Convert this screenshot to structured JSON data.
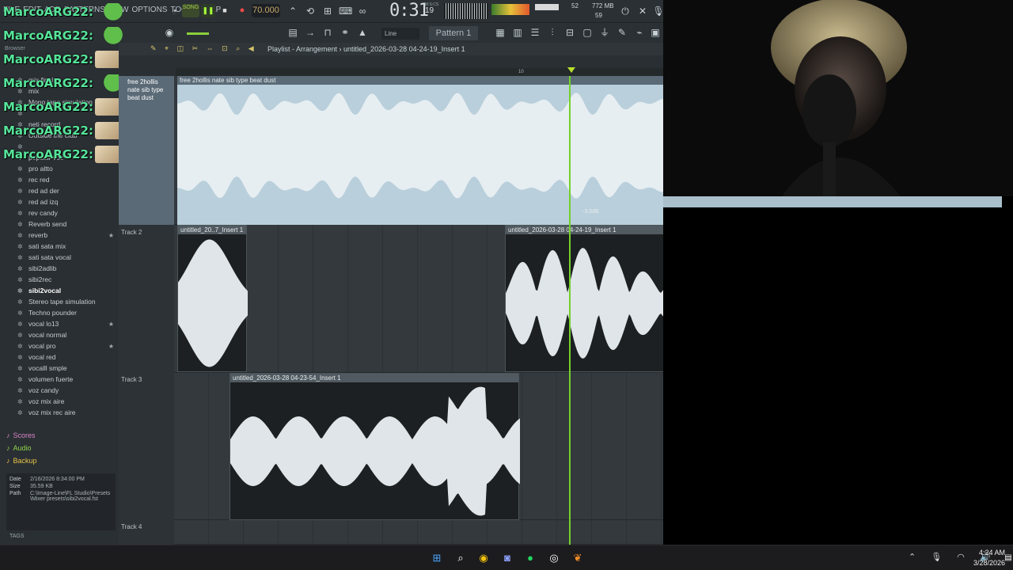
{
  "menus": [
    "FILE",
    "EDIT",
    "ADD",
    "PATTERNS",
    "VIEW",
    "OPTIONS",
    "TOOLS",
    "HELP"
  ],
  "transport": {
    "song_label": "SONG",
    "tempo": "70.000",
    "time": "0:31",
    "time_small": "19",
    "time_unit": "M:S:CS"
  },
  "monitor": {
    "cpu": "52",
    "memory": "772 MB",
    "polyphony": "59"
  },
  "toolbar2": {
    "snap": "Line",
    "pattern": "Pattern 1"
  },
  "chat": {
    "username": "MarcoARG22:",
    "messages": [
      {
        "emote": "frog-emote"
      },
      {
        "emote": "frog-emote"
      },
      {
        "emote": "dog-emote"
      },
      {
        "emote": "frog-emote"
      },
      {
        "emote": "dog-emote"
      },
      {
        "emote": "dog-emote"
      },
      {
        "emote": "dog-emote"
      }
    ]
  },
  "browser": {
    "header": "Browser",
    "items": [
      {
        "label": "mix final",
        "star": false,
        "selected": false
      },
      {
        "label": "mix",
        "star": false,
        "selected": false
      },
      {
        "label": "Mono tape simulation",
        "star": false,
        "selected": false
      },
      {
        "label": "",
        "star": false,
        "selected": false
      },
      {
        "label": "neti record",
        "star": false,
        "selected": false
      },
      {
        "label": "Outside the club",
        "star": false,
        "selected": false
      },
      {
        "label": "",
        "star": false,
        "selected": false
      },
      {
        "label": "popular voc",
        "star": false,
        "selected": false
      },
      {
        "label": "pro altto",
        "star": false,
        "selected": false
      },
      {
        "label": "rec red",
        "star": false,
        "selected": false
      },
      {
        "label": "red ad der",
        "star": false,
        "selected": false
      },
      {
        "label": "red ad izq",
        "star": false,
        "selected": false
      },
      {
        "label": "rev candy",
        "star": false,
        "selected": false
      },
      {
        "label": "Reverb send",
        "star": false,
        "selected": false
      },
      {
        "label": "reverb",
        "star": true,
        "selected": false
      },
      {
        "label": "sati sata mix",
        "star": false,
        "selected": false
      },
      {
        "label": "sati sata vocal",
        "star": false,
        "selected": false
      },
      {
        "label": "sibi2adlib",
        "star": false,
        "selected": false
      },
      {
        "label": "sibi2rec",
        "star": false,
        "selected": false
      },
      {
        "label": "sibi2vocal",
        "star": false,
        "selected": true
      },
      {
        "label": "Stereo tape simulation",
        "star": false,
        "selected": false
      },
      {
        "label": "Techno pounder",
        "star": false,
        "selected": false
      },
      {
        "label": "vocal lo13",
        "star": true,
        "selected": false
      },
      {
        "label": "vocal normal",
        "star": false,
        "selected": false
      },
      {
        "label": "vocal pro",
        "star": true,
        "selected": false
      },
      {
        "label": "vocal red",
        "star": false,
        "selected": false
      },
      {
        "label": "vocalll smple",
        "star": false,
        "selected": false
      },
      {
        "label": "volumen fuerte",
        "star": false,
        "selected": false
      },
      {
        "label": "voz candy",
        "star": false,
        "selected": false
      },
      {
        "label": "voz mix aire",
        "star": false,
        "selected": false
      },
      {
        "label": "voz mix rec aire",
        "star": false,
        "selected": false
      }
    ],
    "categories": [
      {
        "label": "Scores",
        "color": "#d784c8"
      },
      {
        "label": "Audio",
        "color": "#8fd44a"
      },
      {
        "label": "Backup",
        "color": "#e8c348"
      }
    ],
    "fileinfo": {
      "date_k": "Date",
      "date_v": "2/16/2026 8:34:00 PM",
      "size_k": "Size",
      "size_v": "35.59 KB",
      "path_k": "Path",
      "path_v": "C:\\Image-Line\\FL Studio\\Presets\\Mixer presets\\sibi2vocal.fst"
    },
    "tags_label": "TAGS"
  },
  "playlist": {
    "title": "Playlist - Arrangement › untitled_2026-03-28 04-24-19_Insert 1",
    "bar_label": "10",
    "tracks": [
      {
        "name": "free 2hollis nate sib type beat dust"
      },
      {
        "name": "Track 2"
      },
      {
        "name": "Track 3"
      },
      {
        "name": "Track 4"
      }
    ],
    "clips": {
      "beat": "free 2hollis  nate sib type beat dust",
      "clip_a": "untitled_20..7_Insert 1",
      "clip_b": "untitled_2026-03-28 04-24-19_Insert 1",
      "clip_c": "untitled_2026-03-28 04-23-54_Insert 1"
    },
    "db_label": "-3.0dB"
  },
  "taskbar": {
    "time": "4:24 AM",
    "date": "3/28/2026"
  },
  "colors": {
    "accent_green": "#74d12a",
    "chat_name": "#56e59a",
    "beat_wave": "#b9cfdb"
  }
}
